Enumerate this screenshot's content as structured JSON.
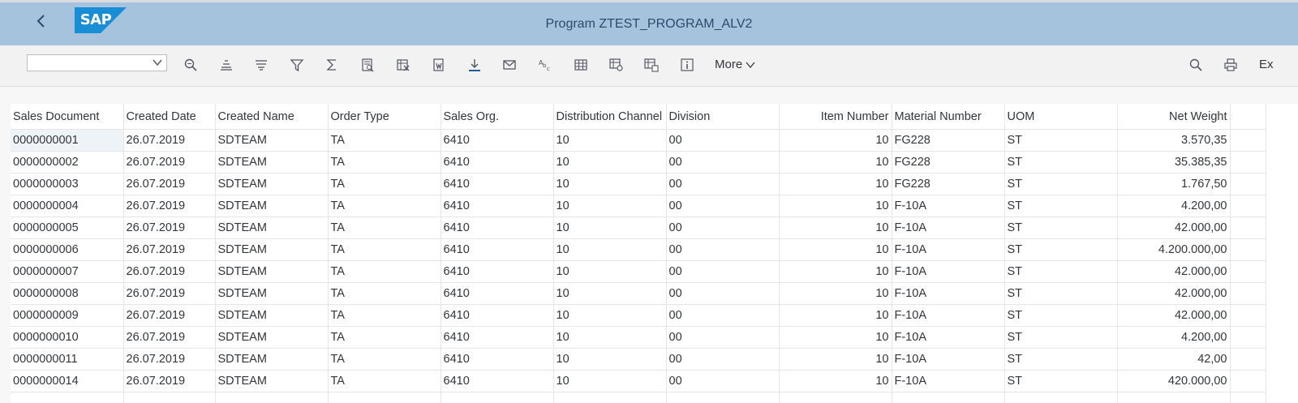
{
  "app": {
    "logo_text": "SAP",
    "title": "Program ZTEST_PROGRAM_ALV2"
  },
  "colors": {
    "shellbar": "#a6c3dd",
    "logo_blue": "#1a8ed4",
    "title": "#2b4b6d"
  },
  "toolbar": {
    "variant_value": "",
    "icons": [
      "search-details-icon",
      "sort-ascending-icon",
      "sort-descending-icon",
      "filter-icon",
      "sum-icon",
      "print-preview-icon",
      "export-spreadsheet-icon",
      "export-word-icon",
      "download-icon",
      "mail-icon",
      "spell-check-icon",
      "layout-icon",
      "change-layout-icon",
      "select-layout-icon",
      "info-icon"
    ],
    "more_label": "More",
    "right_icons": [
      "find-icon",
      "print-icon"
    ],
    "exit_label": "Ex"
  },
  "table": {
    "columns": [
      "Sales Document",
      "Created Date",
      "Created Name",
      "Order Type",
      "Sales Org.",
      "Distribution Channel",
      "Division",
      "Item Number",
      "Material Number",
      "UOM",
      "Net Weight"
    ],
    "rows": [
      [
        "0000000001",
        "26.07.2019",
        "SDTEAM",
        "TA",
        "6410",
        "10",
        "00",
        "10",
        "FG228",
        "ST",
        "3.570,35"
      ],
      [
        "0000000002",
        "26.07.2019",
        "SDTEAM",
        "TA",
        "6410",
        "10",
        "00",
        "10",
        "FG228",
        "ST",
        "35.385,35"
      ],
      [
        "0000000003",
        "26.07.2019",
        "SDTEAM",
        "TA",
        "6410",
        "10",
        "00",
        "10",
        "FG228",
        "ST",
        "1.767,50"
      ],
      [
        "0000000004",
        "26.07.2019",
        "SDTEAM",
        "TA",
        "6410",
        "10",
        "00",
        "10",
        "F-10A",
        "ST",
        "4.200,00"
      ],
      [
        "0000000005",
        "26.07.2019",
        "SDTEAM",
        "TA",
        "6410",
        "10",
        "00",
        "10",
        "F-10A",
        "ST",
        "42.000,00"
      ],
      [
        "0000000006",
        "26.07.2019",
        "SDTEAM",
        "TA",
        "6410",
        "10",
        "00",
        "10",
        "F-10A",
        "ST",
        "4.200.000,00"
      ],
      [
        "0000000007",
        "26.07.2019",
        "SDTEAM",
        "TA",
        "6410",
        "10",
        "00",
        "10",
        "F-10A",
        "ST",
        "42.000,00"
      ],
      [
        "0000000008",
        "26.07.2019",
        "SDTEAM",
        "TA",
        "6410",
        "10",
        "00",
        "10",
        "F-10A",
        "ST",
        "42.000,00"
      ],
      [
        "0000000009",
        "26.07.2019",
        "SDTEAM",
        "TA",
        "6410",
        "10",
        "00",
        "10",
        "F-10A",
        "ST",
        "42.000,00"
      ],
      [
        "0000000010",
        "26.07.2019",
        "SDTEAM",
        "TA",
        "6410",
        "10",
        "00",
        "10",
        "F-10A",
        "ST",
        "4.200,00"
      ],
      [
        "0000000011",
        "26.07.2019",
        "SDTEAM",
        "TA",
        "6410",
        "10",
        "00",
        "10",
        "F-10A",
        "ST",
        "42,00"
      ],
      [
        "0000000014",
        "26.07.2019",
        "SDTEAM",
        "TA",
        "6410",
        "10",
        "00",
        "10",
        "F-10A",
        "ST",
        "420.000,00"
      ],
      [
        "",
        "",
        "",
        "",
        "",
        "",
        "",
        "",
        "",
        "",
        ""
      ]
    ]
  }
}
